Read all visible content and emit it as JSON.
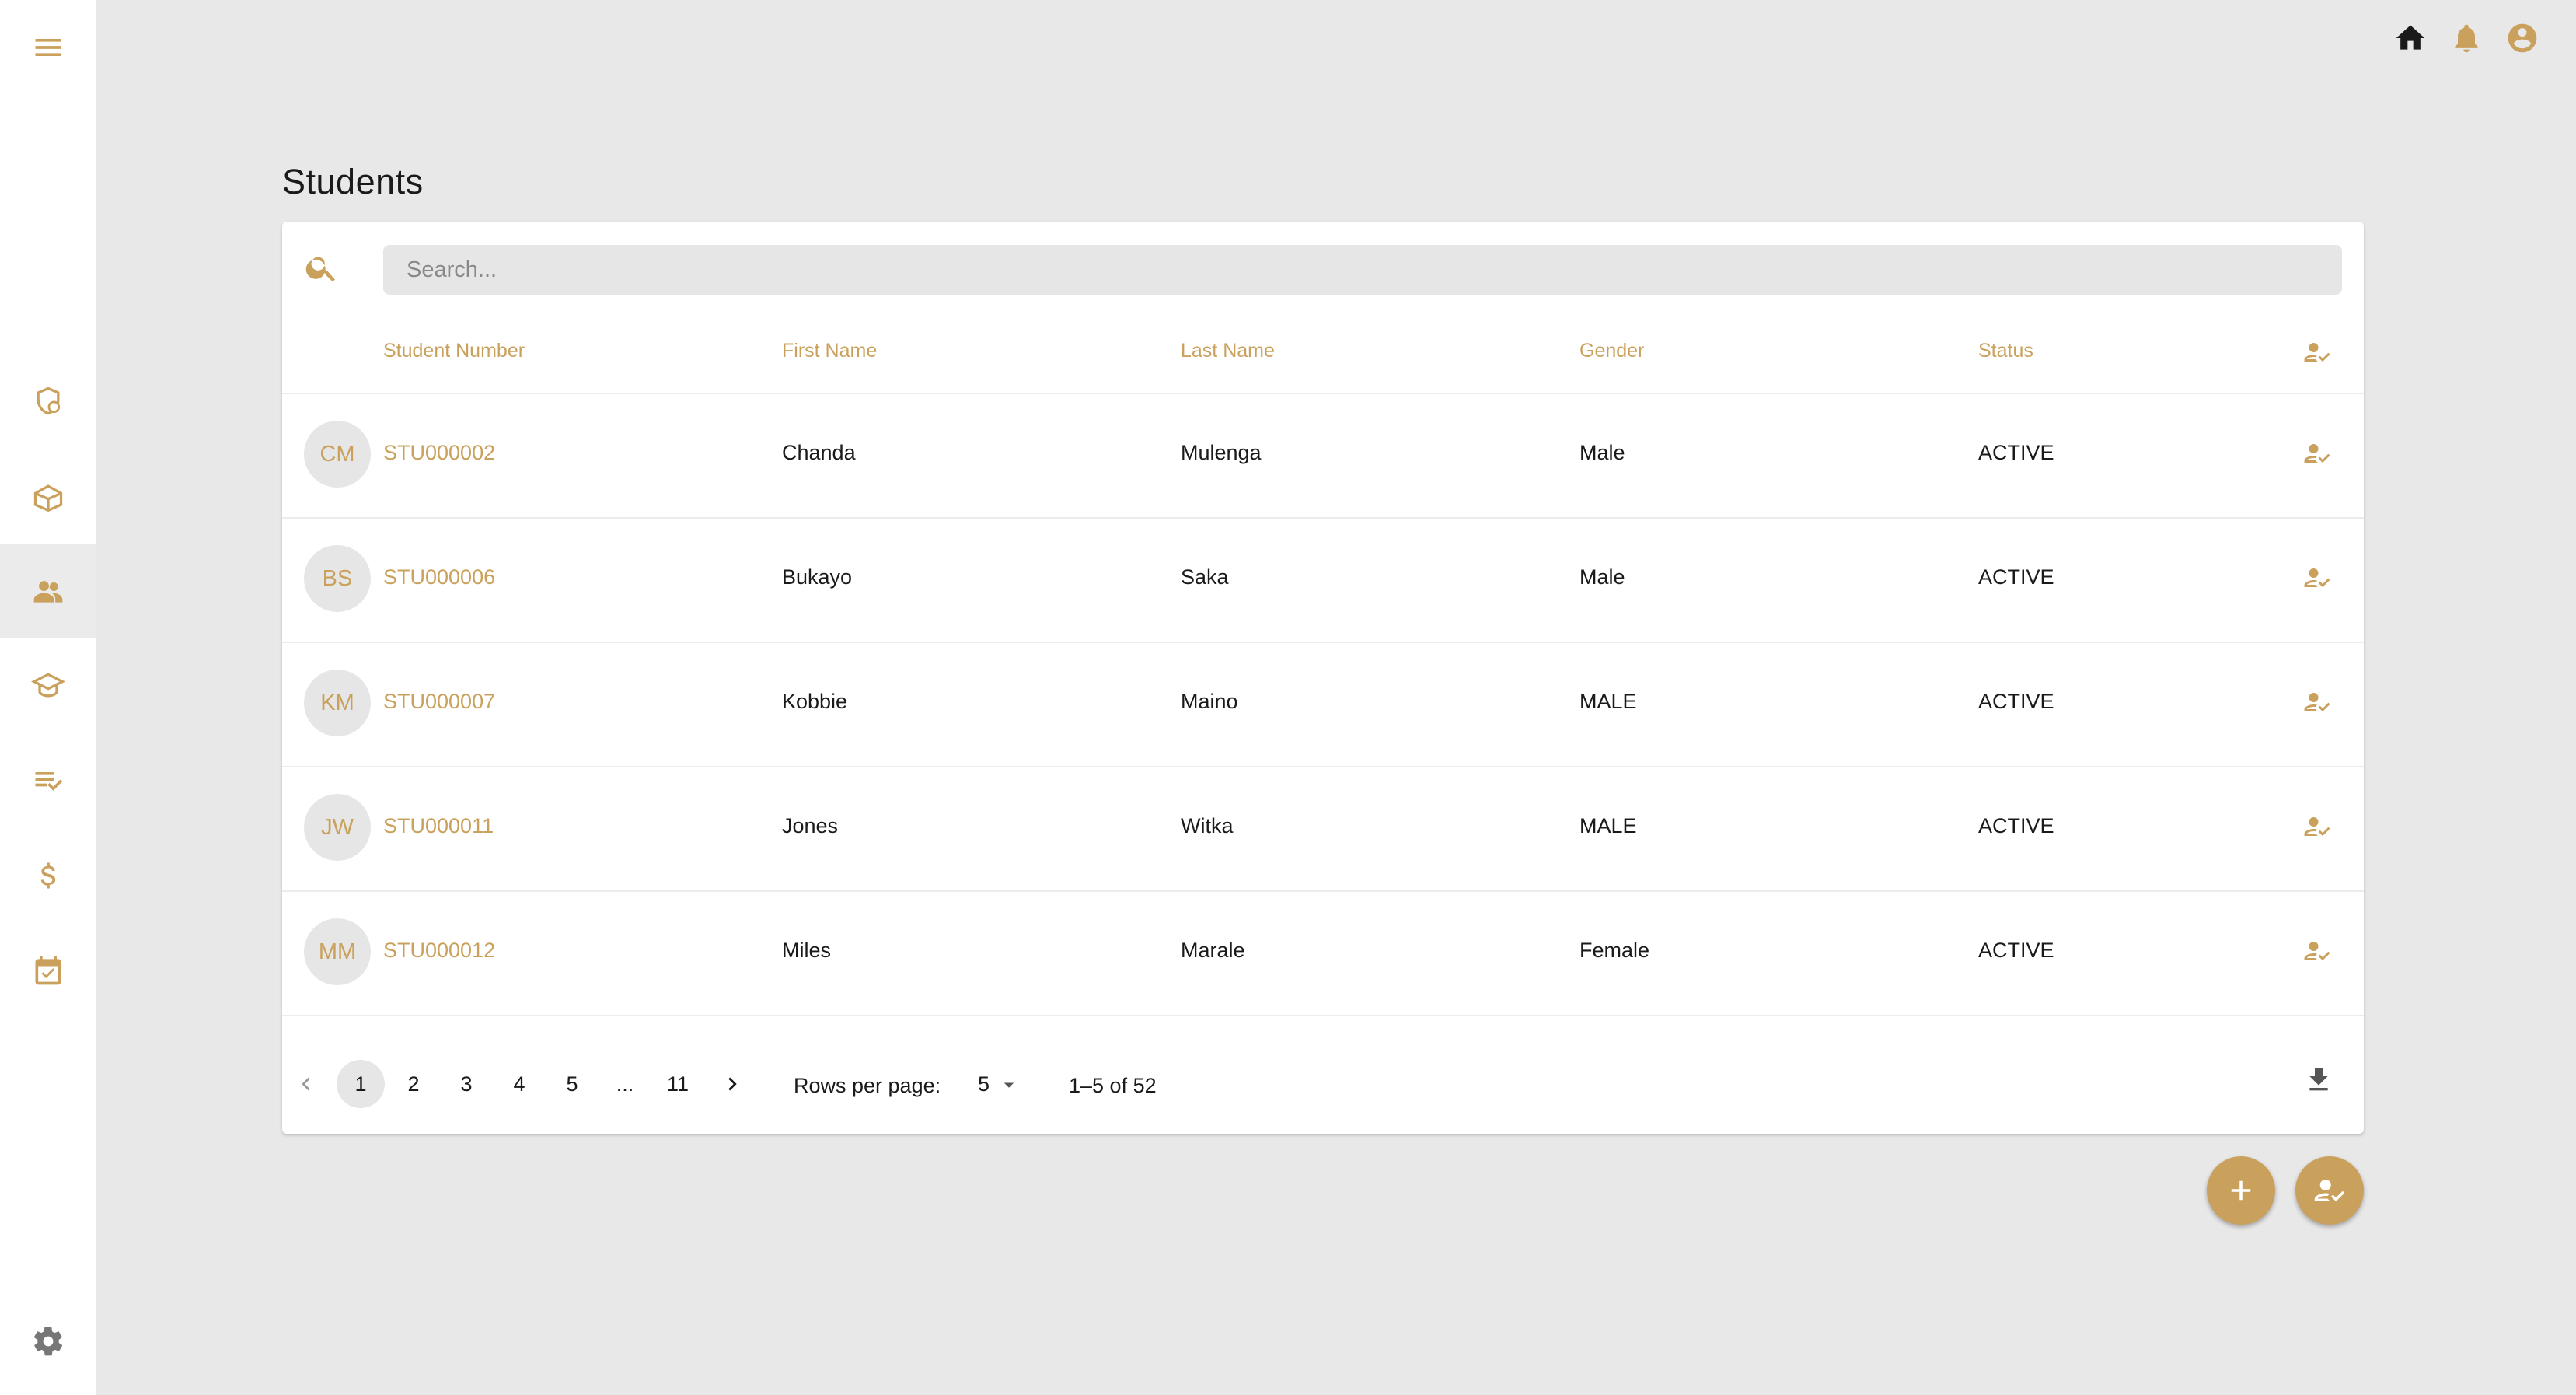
{
  "colors": {
    "accent": "#c9a15c",
    "background": "#e8e8e8",
    "sidebar_active": "#ebebeb",
    "text": "#1a1a1a"
  },
  "sidebar": {
    "menu_icon": "menu-icon",
    "items": [
      {
        "icon": "security-icon",
        "active": false
      },
      {
        "icon": "book-open-icon",
        "active": false
      },
      {
        "icon": "people-icon",
        "active": true
      },
      {
        "icon": "school-icon",
        "active": false
      },
      {
        "icon": "playlist-check-icon",
        "active": false
      },
      {
        "icon": "dollar-icon",
        "active": false
      },
      {
        "icon": "event-available-icon",
        "active": false
      }
    ],
    "settings_icon": "gear-icon"
  },
  "topbar": {
    "icons": [
      "home-icon",
      "bell-icon",
      "account-circle-icon"
    ]
  },
  "page": {
    "title": "Students"
  },
  "search": {
    "placeholder": "Search...",
    "value": ""
  },
  "table": {
    "columns": [
      "Student Number",
      "First Name",
      "Last Name",
      "Gender",
      "Status"
    ],
    "rows": [
      {
        "initials": "CM",
        "student_number": "STU000002",
        "first_name": "Chanda",
        "last_name": "Mulenga",
        "gender": "Male",
        "status": "ACTIVE"
      },
      {
        "initials": "BS",
        "student_number": "STU000006",
        "first_name": "Bukayo",
        "last_name": "Saka",
        "gender": "Male",
        "status": "ACTIVE"
      },
      {
        "initials": "KM",
        "student_number": "STU000007",
        "first_name": "Kobbie",
        "last_name": "Maino",
        "gender": "MALE",
        "status": "ACTIVE"
      },
      {
        "initials": "JW",
        "student_number": "STU000011",
        "first_name": "Jones",
        "last_name": "Witka",
        "gender": "MALE",
        "status": "ACTIVE"
      },
      {
        "initials": "MM",
        "student_number": "STU000012",
        "first_name": "Miles",
        "last_name": "Marale",
        "gender": "Female",
        "status": "ACTIVE"
      }
    ]
  },
  "pagination": {
    "pages": [
      "1",
      "2",
      "3",
      "4",
      "5",
      "...",
      "11"
    ],
    "current_page": "1",
    "rows_per_page_label": "Rows per page:",
    "rows_per_page": "5",
    "range_text": "1–5 of 52"
  },
  "fabs": [
    "add-icon",
    "person-check-icon"
  ]
}
